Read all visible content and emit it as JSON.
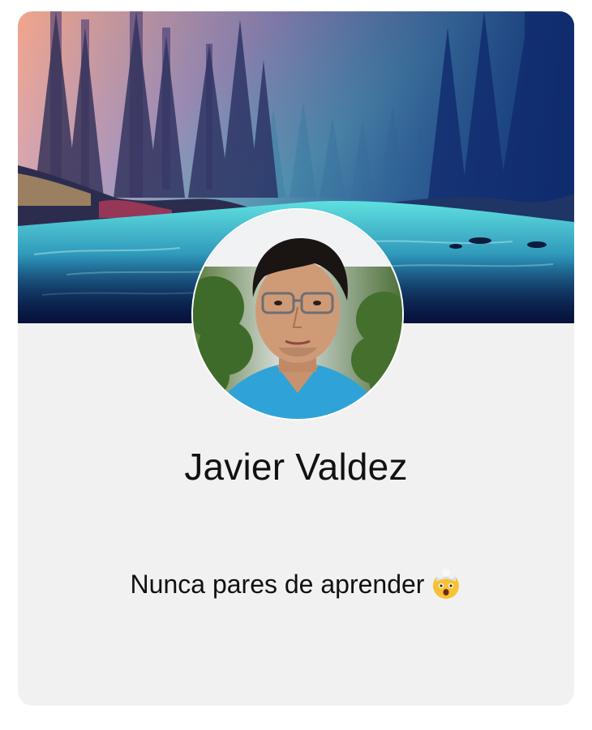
{
  "profile": {
    "name": "Javier Valdez",
    "bio": "Nunca pares de aprender"
  },
  "icons": {
    "cover": "forest-river-cover-image",
    "avatar": "profile-photo",
    "bio_emoji": "exploding-head-emoji"
  },
  "colors": {
    "card_background": "#f1f1f2",
    "page_background": "#ffffff",
    "text": "#111111"
  }
}
